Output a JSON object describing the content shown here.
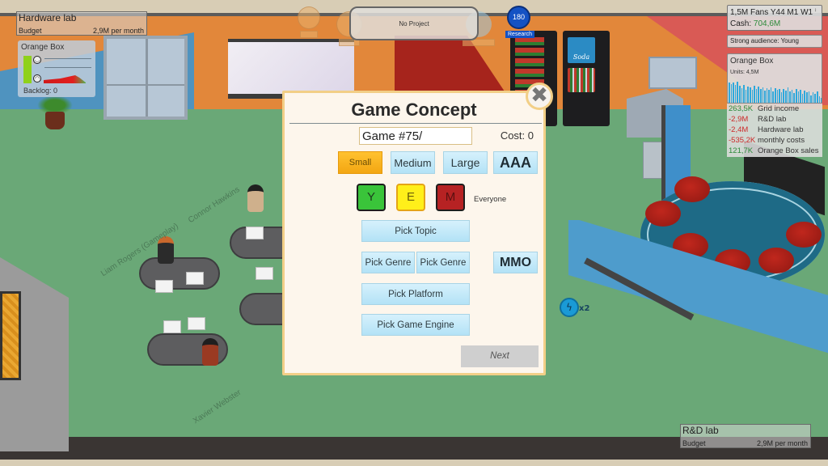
{
  "hud": {
    "hardware_lab": {
      "title": "Hardware lab",
      "budget_label": "Budget",
      "budget_value": "2,9M per month"
    },
    "rd_lab": {
      "title": "R&D lab",
      "budget_label": "Budget",
      "budget_value": "2,9M per month"
    },
    "product_box": {
      "title": "Orange Box",
      "backlog": "Backlog: 0"
    },
    "project": {
      "label": "No Project"
    },
    "research": {
      "points": "180",
      "label": "Research"
    },
    "stats": {
      "fans_line": "1,5M Fans Y44 M1 W1",
      "cash_label": "Cash: ",
      "cash_value": "704,6M",
      "expand_icon": "↕"
    },
    "audience": "Strong audience: Young",
    "sales": {
      "title": "Orange Box",
      "units": "Units: 4,5M",
      "bars": [
        0.82,
        0.78,
        0.84,
        0.75,
        0.86,
        0.7,
        0.6,
        0.72,
        0.55,
        0.68,
        0.62,
        0.52,
        0.7,
        0.58,
        0.66,
        0.56,
        0.62,
        0.5,
        0.6,
        0.54,
        0.64,
        0.48,
        0.6,
        0.52,
        0.58,
        0.44,
        0.56,
        0.5,
        0.62,
        0.48,
        0.54,
        0.4,
        0.58,
        0.46,
        0.52,
        0.38,
        0.5,
        0.42,
        0.48,
        0.3,
        0.44,
        0.36,
        0.46,
        0.28,
        0.2
      ]
    },
    "finances": [
      {
        "value": "263,5K",
        "label": "Grid income",
        "sign": "pos"
      },
      {
        "value": "-2,9M",
        "label": "R&D lab",
        "sign": "neg"
      },
      {
        "value": "-2,4M",
        "label": "Hardware lab",
        "sign": "neg"
      },
      {
        "value": "-535,2K",
        "label": "monthly costs",
        "sign": "neg"
      },
      {
        "value": "121,7K",
        "label": "Orange Box sales",
        "sign": "pos"
      }
    ]
  },
  "scene": {
    "employees": [
      "Liam Rogers (Gameplay)",
      "Connor Hawkins",
      "Xavier Webster"
    ],
    "boost": {
      "icon": "lightning-icon",
      "multiplier": "x2"
    },
    "soda_label": "Soda"
  },
  "dialog": {
    "title": "Game Concept",
    "name_value": "Game #75/",
    "cost": "Cost: 0",
    "sizes": [
      {
        "label": "Small",
        "selected": true
      },
      {
        "label": "Medium",
        "selected": false
      },
      {
        "label": "Large",
        "selected": false
      },
      {
        "label": "AAA",
        "selected": false
      }
    ],
    "ratings": [
      {
        "label": "Y",
        "color": "#3ac43a"
      },
      {
        "label": "E",
        "color": "#ffef1a",
        "selected": true
      },
      {
        "label": "M",
        "color": "#b62223"
      }
    ],
    "rating_text": "Everyone",
    "pick_topic": "Pick Topic",
    "pick_genre": [
      "Pick Genre",
      "Pick Genre"
    ],
    "mmo": "MMO",
    "pick_platform": "Pick Platform",
    "pick_engine": "Pick Game Engine",
    "next": "Next",
    "close_icon": "✖"
  },
  "colors": {
    "dialog_bg": "#fdf6ec",
    "dialog_border": "#f2cf87",
    "button_blue": "#b3e2f6",
    "selected_orange": "#f3a612",
    "research_blue": "#1452c4",
    "positive_green": "#2d8a3a",
    "negative_red": "#cc2a2a"
  }
}
